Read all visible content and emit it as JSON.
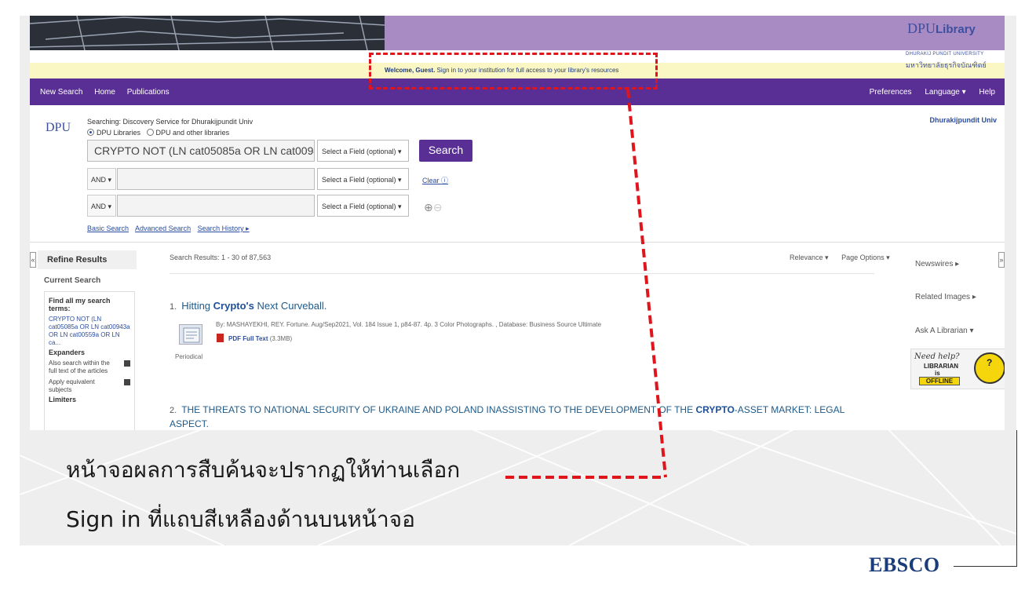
{
  "header": {
    "welcome_bold": "Welcome, Guest.",
    "welcome_rest": " Sign in to your institution for full access to your library's resources",
    "logo_main": "DPU",
    "logo_lib": "Library",
    "logo_sub": "DHURAKIJ PUNDIT UNIVERSITY",
    "logo_thai": "มหาวิทยาลัยธุรกิจบัณฑิตย์"
  },
  "nav": {
    "left": [
      "New Search",
      "Home",
      "Publications"
    ],
    "right": [
      "Preferences",
      "Language ▾",
      "Help"
    ]
  },
  "search": {
    "logo": "DPU",
    "searching": "Searching: Discovery Service for Dhurakijpundit Univ",
    "scope_1": "DPU Libraries",
    "scope_2": "DPU and other libraries",
    "owner": "Dhurakijpundit Univ",
    "query": "CRYPTO NOT (LN cat05085a OR LN cat00943a OR LN cat00559a OR LN ca...",
    "field_label": "Select a Field (optional) ▾",
    "bool_1": "AND ▾",
    "bool_2": "AND ▾",
    "search_button": "Search",
    "clear": "Clear",
    "basic": "Basic Search",
    "advanced": "Advanced Search",
    "history": "Search History ▸"
  },
  "refine": {
    "title": "Refine Results",
    "current": "Current Search",
    "find_all": "Find all my search terms:",
    "query_text": "CRYPTO NOT (LN cat05085a OR LN cat00943a OR LN cat00559a OR LN ca...",
    "expanders": "Expanders",
    "opt1": "Also search within the full text of the articles",
    "opt2": "Apply equivalent subjects",
    "limiters": "Limiters"
  },
  "results": {
    "count": "Search Results: 1 - 30 of 87,563",
    "sort": "Relevance ▾",
    "page_options": "Page Options ▾",
    "r1_num": "1.",
    "r1_pre": "Hitting ",
    "r1_bold": "Crypto's",
    "r1_post": " Next Curveball.",
    "r1_by": "By: MASHAYEKHI, REY. Fortune. Aug/Sep2021, Vol. 184 Issue 1, p84-87. 4p. 3 Color Photographs. , Database: Business Source Ultimate",
    "r1_pdf": "PDF Full Text",
    "r1_size": "(3.3MB)",
    "r1_type": "Periodical",
    "r2_num": "2.",
    "r2_pre": "THE THREATS TO NATIONAL SECURITY OF UKRAINE AND POLAND INASSISTING TO THE DEVELOPMENT OF THE ",
    "r2_bold": "CRYPTO",
    "r2_post": "-ASSET MARKET: LEGAL ASPECT."
  },
  "sidebar_right": {
    "newswires": "Newswires ▸",
    "images": "Related Images ▸",
    "ask": "Ask A Librarian ▾",
    "help_title": "Need help?",
    "help_lib": "LIBRARIAN",
    "help_is": "is",
    "help_off": "OFFLINE"
  },
  "caption": {
    "line1": "หน้าจอผลการสืบค้นจะปรากฏให้ท่านเลือก",
    "line2": "Sign in ที่แถบสีเหลืองด้านบนหน้าจอ"
  },
  "brand": "EBSCO",
  "colors": {
    "nav": "#5a2f95",
    "banner": "#a98bc4",
    "welcome": "#fbf7c4",
    "annotation": "#e0141b"
  }
}
